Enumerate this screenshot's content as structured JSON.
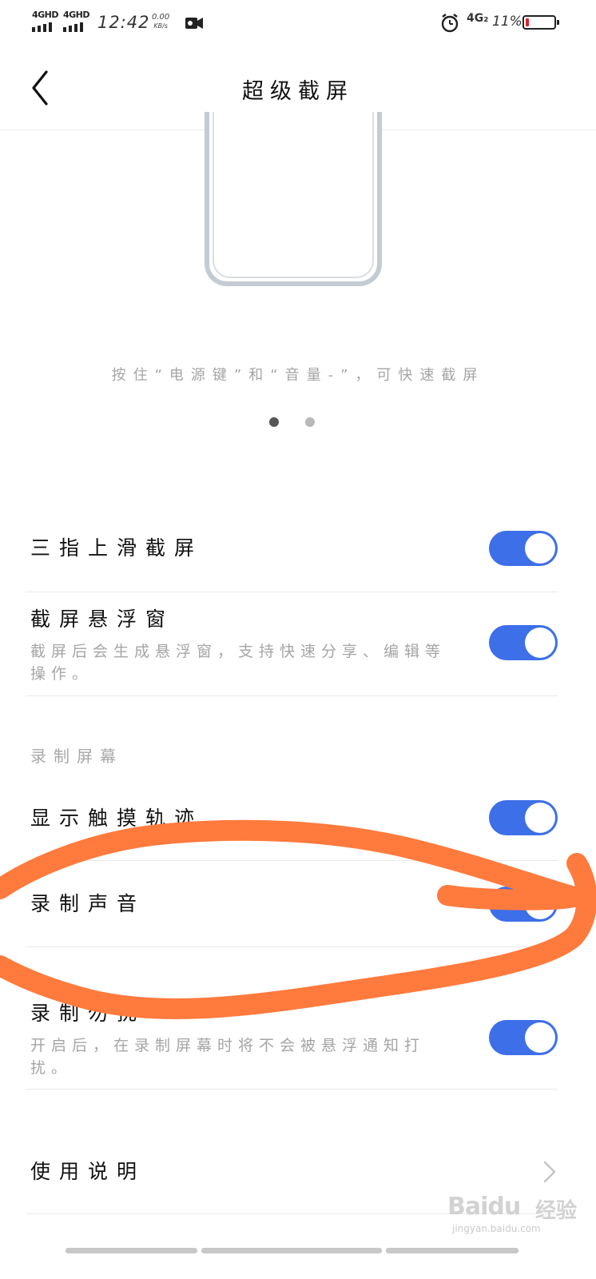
{
  "status_bar": {
    "sim1_label": "4GHD",
    "sim2_label": "4GHD",
    "time": "12:42",
    "net_speed_value": "0.00",
    "net_speed_unit": "KB/s",
    "network2_label": "4G₂",
    "battery_percent": "11%",
    "battery_level": 0.11,
    "battery_color": "#e0202a"
  },
  "header": {
    "title": "超级截屏"
  },
  "illustration": {
    "hint": "按住“电源键”和“音量-”，可快速截屏",
    "pager_active_color": "#555555",
    "pager_inactive_color": "#b8b8b8"
  },
  "settings": [
    {
      "title": "三指上滑截屏",
      "toggle_on": true
    },
    {
      "title": "截屏悬浮窗",
      "desc": "截屏后会生成悬浮窗，支持快速分享、编辑等操作。",
      "toggle_on": true
    }
  ],
  "record_section": {
    "label": "录制屏幕",
    "items": [
      {
        "title": "显示触摸轨迹",
        "toggle_on": true
      },
      {
        "title": "录制声音",
        "toggle_on": true
      },
      {
        "title": "录制勿扰",
        "desc": "开启后，在录制屏幕时将不会被悬浮通知打扰。",
        "toggle_on": true
      }
    ]
  },
  "instructions": {
    "title": "使用说明"
  },
  "watermark": {
    "brand": "Baidu",
    "brand_cn": "经验",
    "site": "jingyan.baidu.com"
  },
  "colors": {
    "accent": "#3d6fe8",
    "annotation": "#ff7a3d"
  },
  "icons": [
    "back-arrow-icon",
    "video-camera-icon",
    "alarm-icon",
    "battery-icon",
    "chevron-right-icon"
  ]
}
